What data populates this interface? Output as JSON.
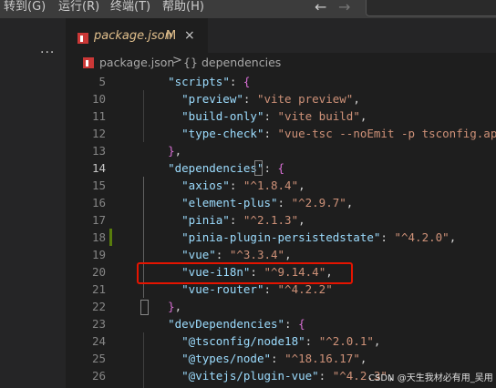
{
  "menu": {
    "items": [
      "转到(G)",
      "运行(R)",
      "终端(T)",
      "帮助(H)"
    ],
    "back_icon": "arrow-left-icon",
    "forward_icon": "arrow-right-icon"
  },
  "sidebar": {
    "more_label": "···"
  },
  "tab": {
    "filename": "package.json",
    "modified": "M",
    "close": "×"
  },
  "breadcrumb": {
    "file": "package.json",
    "separator": ">",
    "symbol_icon": "{}",
    "item": "dependencies"
  },
  "editor": {
    "lines": [
      {
        "n": "5",
        "parts": [
          [
            "p",
            "    "
          ],
          [
            "k",
            "\"scripts\""
          ],
          [
            "p",
            ": "
          ],
          [
            "b1",
            "{"
          ]
        ]
      },
      {
        "n": "10",
        "parts": [
          [
            "p",
            "      "
          ],
          [
            "k",
            "\"preview\""
          ],
          [
            "p",
            ": "
          ],
          [
            "s",
            "\"vite preview\""
          ],
          [
            "p",
            ","
          ]
        ]
      },
      {
        "n": "11",
        "parts": [
          [
            "p",
            "      "
          ],
          [
            "k",
            "\"build-only\""
          ],
          [
            "p",
            ": "
          ],
          [
            "s",
            "\"vite build\""
          ],
          [
            "p",
            ","
          ]
        ]
      },
      {
        "n": "12",
        "parts": [
          [
            "p",
            "      "
          ],
          [
            "k",
            "\"type-check\""
          ],
          [
            "p",
            ": "
          ],
          [
            "s",
            "\"vue-tsc --noEmit -p tsconfig.app.j"
          ]
        ]
      },
      {
        "n": "13",
        "parts": [
          [
            "p",
            "    "
          ],
          [
            "b1",
            "}"
          ],
          [
            "p",
            ","
          ]
        ]
      },
      {
        "n": "14",
        "parts": [
          [
            "p",
            "    "
          ],
          [
            "k",
            "\"dependencies\""
          ],
          [
            "p",
            ": "
          ],
          [
            "b1",
            "{"
          ]
        ],
        "current": true
      },
      {
        "n": "15",
        "parts": [
          [
            "p",
            "      "
          ],
          [
            "k",
            "\"axios\""
          ],
          [
            "p",
            ": "
          ],
          [
            "s",
            "\"^1.8.4\""
          ],
          [
            "p",
            ","
          ]
        ]
      },
      {
        "n": "16",
        "parts": [
          [
            "p",
            "      "
          ],
          [
            "k",
            "\"element-plus\""
          ],
          [
            "p",
            ": "
          ],
          [
            "s",
            "\"^2.9.7\""
          ],
          [
            "p",
            ","
          ]
        ]
      },
      {
        "n": "17",
        "parts": [
          [
            "p",
            "      "
          ],
          [
            "k",
            "\"pinia\""
          ],
          [
            "p",
            ": "
          ],
          [
            "s",
            "\"^2.1.3\""
          ],
          [
            "p",
            ","
          ]
        ]
      },
      {
        "n": "18",
        "parts": [
          [
            "p",
            "      "
          ],
          [
            "k",
            "\"pinia-plugin-persistedstate\""
          ],
          [
            "p",
            ": "
          ],
          [
            "s",
            "\"^4.2.0\""
          ],
          [
            "p",
            ","
          ]
        ]
      },
      {
        "n": "19",
        "parts": [
          [
            "p",
            "      "
          ],
          [
            "k",
            "\"vue\""
          ],
          [
            "p",
            ": "
          ],
          [
            "s",
            "\"^3.3.4\""
          ],
          [
            "p",
            ","
          ]
        ]
      },
      {
        "n": "20",
        "parts": [
          [
            "p",
            "      "
          ],
          [
            "k",
            "\"vue-i18n\""
          ],
          [
            "p",
            ": "
          ],
          [
            "s",
            "\"^9.14.4\""
          ],
          [
            "p",
            ","
          ]
        ]
      },
      {
        "n": "21",
        "parts": [
          [
            "p",
            "      "
          ],
          [
            "k",
            "\"vue-router\""
          ],
          [
            "p",
            ": "
          ],
          [
            "s",
            "\"^4.2.2\""
          ]
        ]
      },
      {
        "n": "22",
        "parts": [
          [
            "p",
            "    "
          ],
          [
            "b1",
            "}"
          ],
          [
            "p",
            ","
          ]
        ]
      },
      {
        "n": "23",
        "parts": [
          [
            "p",
            "    "
          ],
          [
            "k",
            "\"devDependencies\""
          ],
          [
            "p",
            ": "
          ],
          [
            "b1",
            "{"
          ]
        ]
      },
      {
        "n": "24",
        "parts": [
          [
            "p",
            "      "
          ],
          [
            "k",
            "\"@tsconfig/node18\""
          ],
          [
            "p",
            ": "
          ],
          [
            "s",
            "\"^2.0.1\""
          ],
          [
            "p",
            ","
          ]
        ]
      },
      {
        "n": "25",
        "parts": [
          [
            "p",
            "      "
          ],
          [
            "k",
            "\"@types/node\""
          ],
          [
            "p",
            ": "
          ],
          [
            "s",
            "\"^18.16.17\""
          ],
          [
            "p",
            ","
          ]
        ]
      },
      {
        "n": "26",
        "parts": [
          [
            "p",
            "      "
          ],
          [
            "k",
            "\"@vitejs/plugin-vue\""
          ],
          [
            "p",
            ": "
          ],
          [
            "s",
            "\"^4.2.3\""
          ],
          [
            "p",
            ","
          ]
        ]
      }
    ]
  },
  "watermark": "CSDN @天生我材必有用_吴用",
  "colors": {
    "key": "#9cdcfe",
    "string": "#ce9178",
    "bracket": "#da70d6",
    "highlight": "#e51400",
    "git_added": "#587c0c"
  }
}
